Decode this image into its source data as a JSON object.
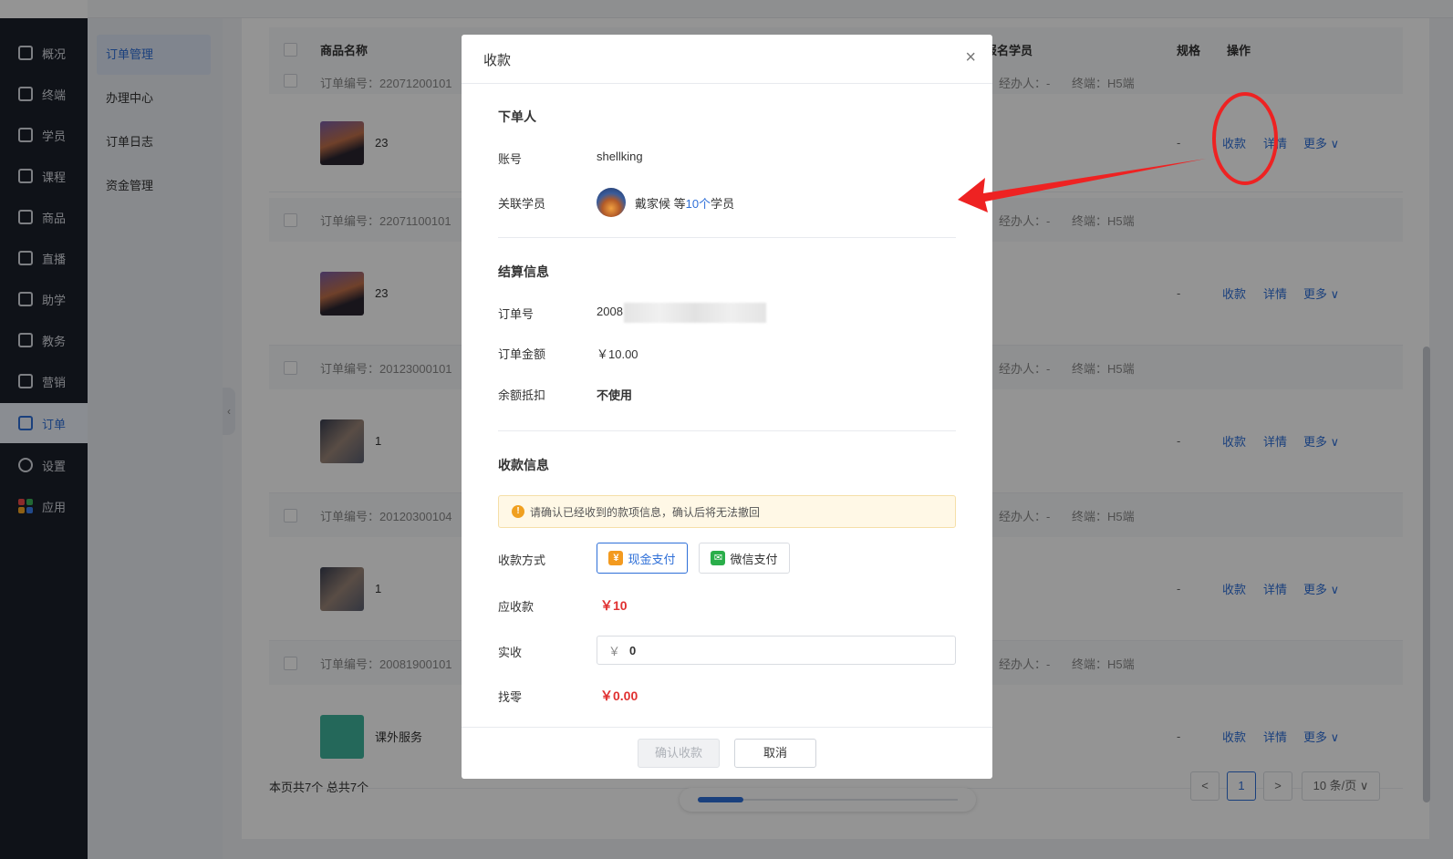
{
  "nav": {
    "items": [
      {
        "label": "概况"
      },
      {
        "label": "终端"
      },
      {
        "label": "学员"
      },
      {
        "label": "课程"
      },
      {
        "label": "商品"
      },
      {
        "label": "直播"
      },
      {
        "label": "助学"
      },
      {
        "label": "教务"
      },
      {
        "label": "营销"
      },
      {
        "label": "订单"
      },
      {
        "label": "设置"
      },
      {
        "label": "应用"
      }
    ],
    "active": "订单"
  },
  "subnav": {
    "items": [
      {
        "label": "订单管理"
      },
      {
        "label": "办理中心"
      },
      {
        "label": "订单日志"
      },
      {
        "label": "资金管理"
      }
    ],
    "active": "订单管理"
  },
  "table": {
    "headers": {
      "product": "商品名称",
      "students": "报名学员",
      "spec": "规格",
      "ops": "操作"
    },
    "orders": [
      {
        "order_no": "订单编号：22071200101",
        "handler": "经办人：-",
        "terminal": "终端：H5端",
        "product": "23",
        "spec": "-"
      },
      {
        "order_no": "订单编号：22071100101",
        "handler": "经办人：-",
        "terminal": "终端：H5端",
        "product": "23",
        "spec": "-"
      },
      {
        "order_no": "订单编号：20123000101",
        "handler": "经办人：-",
        "terminal": "终端：H5端",
        "product": "1",
        "spec": "-"
      },
      {
        "order_no": "订单编号：20120300104",
        "handler": "经办人：-",
        "terminal": "终端：H5端",
        "product": "1",
        "spec": "-"
      },
      {
        "order_no": "订单编号：20081900101",
        "handler": "经办人：-",
        "terminal": "终端：H5端",
        "product": "课外服务",
        "spec": "-"
      }
    ],
    "actions": {
      "collect": "收款",
      "detail": "详情",
      "more": "更多 ∨"
    }
  },
  "footer": {
    "summary": "本页共7个 总共7个",
    "prev": "<",
    "page": "1",
    "next": ">",
    "page_size": "10 条/页 ∨"
  },
  "modal": {
    "title": "收款",
    "close": "×",
    "orderer_section": "下单人",
    "account_label": "账号",
    "account_value": "shellking",
    "students_label": "关联学员",
    "students_name": "戴家候 等",
    "students_count": "10个",
    "students_suffix": "学员",
    "settle_section": "结算信息",
    "order_no_label": "订单号",
    "order_no_value": "2008",
    "amount_label": "订单金额",
    "amount_value": "￥10.00",
    "balance_label": "余额抵扣",
    "balance_value": "不使用",
    "pay_section": "收款信息",
    "notice": "请确认已经收到的款项信息，确认后将无法撤回",
    "method_label": "收款方式",
    "method_cash": "现金支付",
    "method_wechat": "微信支付",
    "due_label": "应收款",
    "due_value": "￥10",
    "received_label": "实收",
    "received_currency": "￥",
    "received_value": "0",
    "change_label": "找零",
    "change_value": "￥0.00",
    "confirm": "确认收款",
    "cancel": "取消"
  },
  "colors": {
    "accent": "#2e6fd8",
    "danger": "#e03030",
    "annotation": "#ee2222"
  }
}
